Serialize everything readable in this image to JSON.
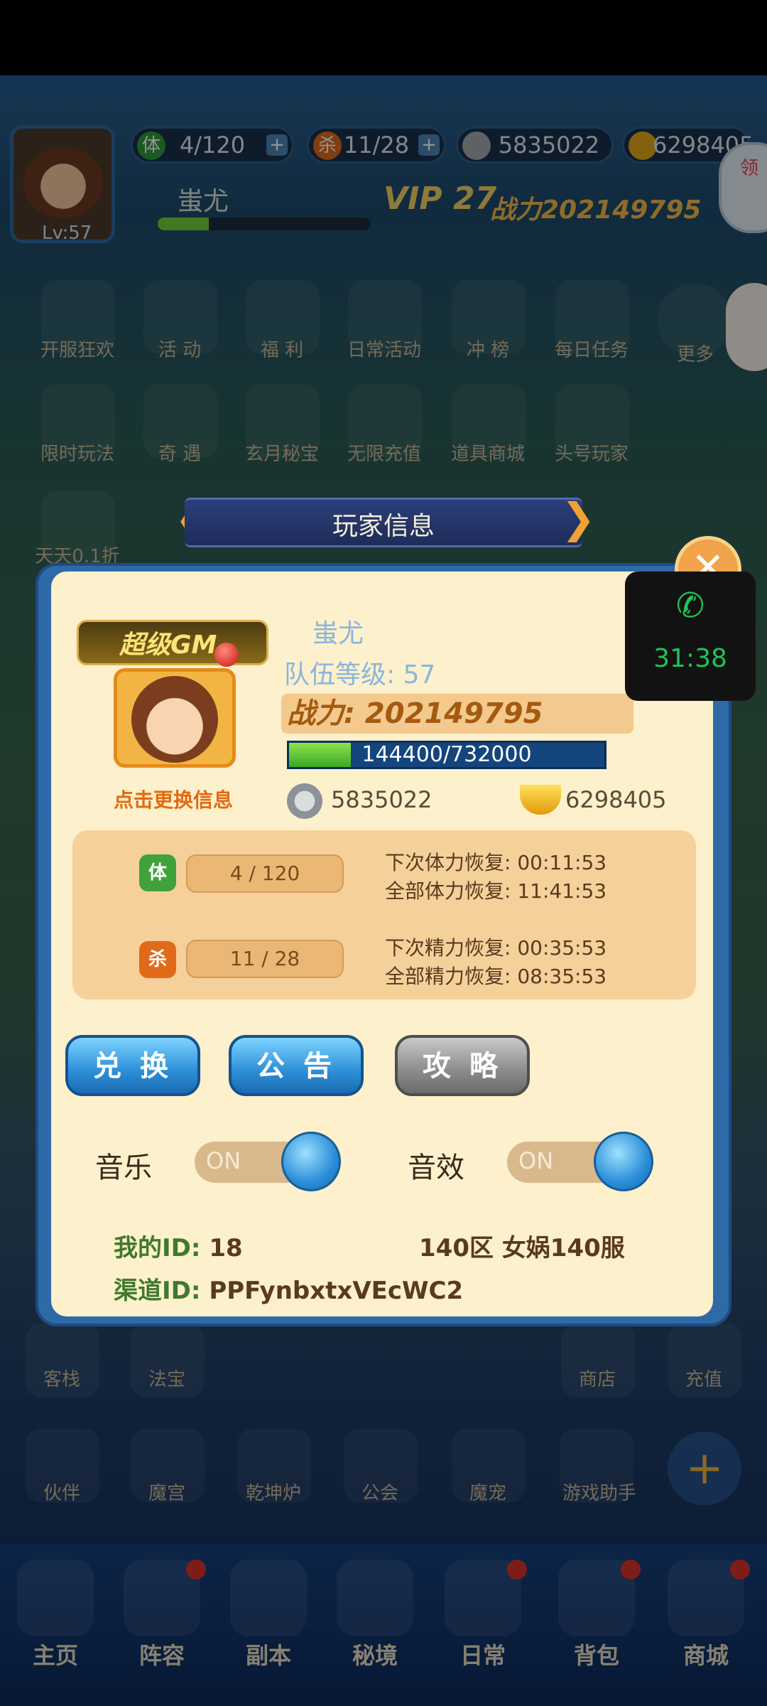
{
  "hud": {
    "level": "Lv:57",
    "stamina_icon": "体",
    "stamina": "4/120",
    "energy_icon": "杀",
    "energy": "11/28",
    "silver": "5835022",
    "gold": "6298405",
    "player_name": "蚩尤",
    "vip": "VIP 27",
    "power": "战力202149795",
    "side_badge": "领"
  },
  "background_menu": [
    "开服狂欢",
    "活 动",
    "福 利",
    "日常活动",
    "冲 榜",
    "每日任务",
    "更多",
    "限时玩法",
    "奇 遇",
    "玄月秘宝",
    "无限充值",
    "道具商城",
    "头号玩家",
    "天天0.1折",
    "客栈",
    "法宝",
    "商店",
    "充值",
    "伙伴",
    "魔宫",
    "乾坤炉",
    "公会",
    "魔宠",
    "游戏助手"
  ],
  "dialog": {
    "title": "玩家信息",
    "gm_badge": "超级GM",
    "change_info": "点击更换信息",
    "name": "蚩尤",
    "team_level": "队伍等级: 57",
    "power": "战力: 202149795",
    "exp": "144400/732000",
    "exp_ratio": 0.197,
    "silver": "5835022",
    "gold": "6298405",
    "stamina": {
      "icon": "体",
      "value": "4 / 120",
      "next_label": "下次体力恢复:",
      "next_time": "00:11:53",
      "all_label": "全部体力恢复:",
      "all_time": "11:41:53"
    },
    "energy": {
      "icon": "杀",
      "value": "11 / 28",
      "next_label": "下次精力恢复:",
      "next_time": "00:35:53",
      "all_label": "全部精力恢复:",
      "all_time": "08:35:53"
    },
    "buttons": {
      "exchange": "兑 换",
      "notice": "公 告",
      "guide": "攻 略"
    },
    "music_label": "音乐",
    "music_state": "ON",
    "sound_label": "音效",
    "sound_state": "ON",
    "my_id_label": "我的ID:",
    "my_id": "18",
    "server": "140区 女娲140服",
    "channel_label": "渠道ID:",
    "channel_id": "PPFynbxtxVEcWC2"
  },
  "call": {
    "time": "31:38"
  },
  "bottom_nav": [
    "主页",
    "阵容",
    "副本",
    "秘境",
    "日常",
    "背包",
    "商城"
  ],
  "colors": {
    "panel_bg": "#fdf0cc",
    "accent_blue": "#2c8fd8",
    "power_text": "#a45a10",
    "id_green": "#3f7a2c",
    "call_green": "#1fc25a"
  }
}
